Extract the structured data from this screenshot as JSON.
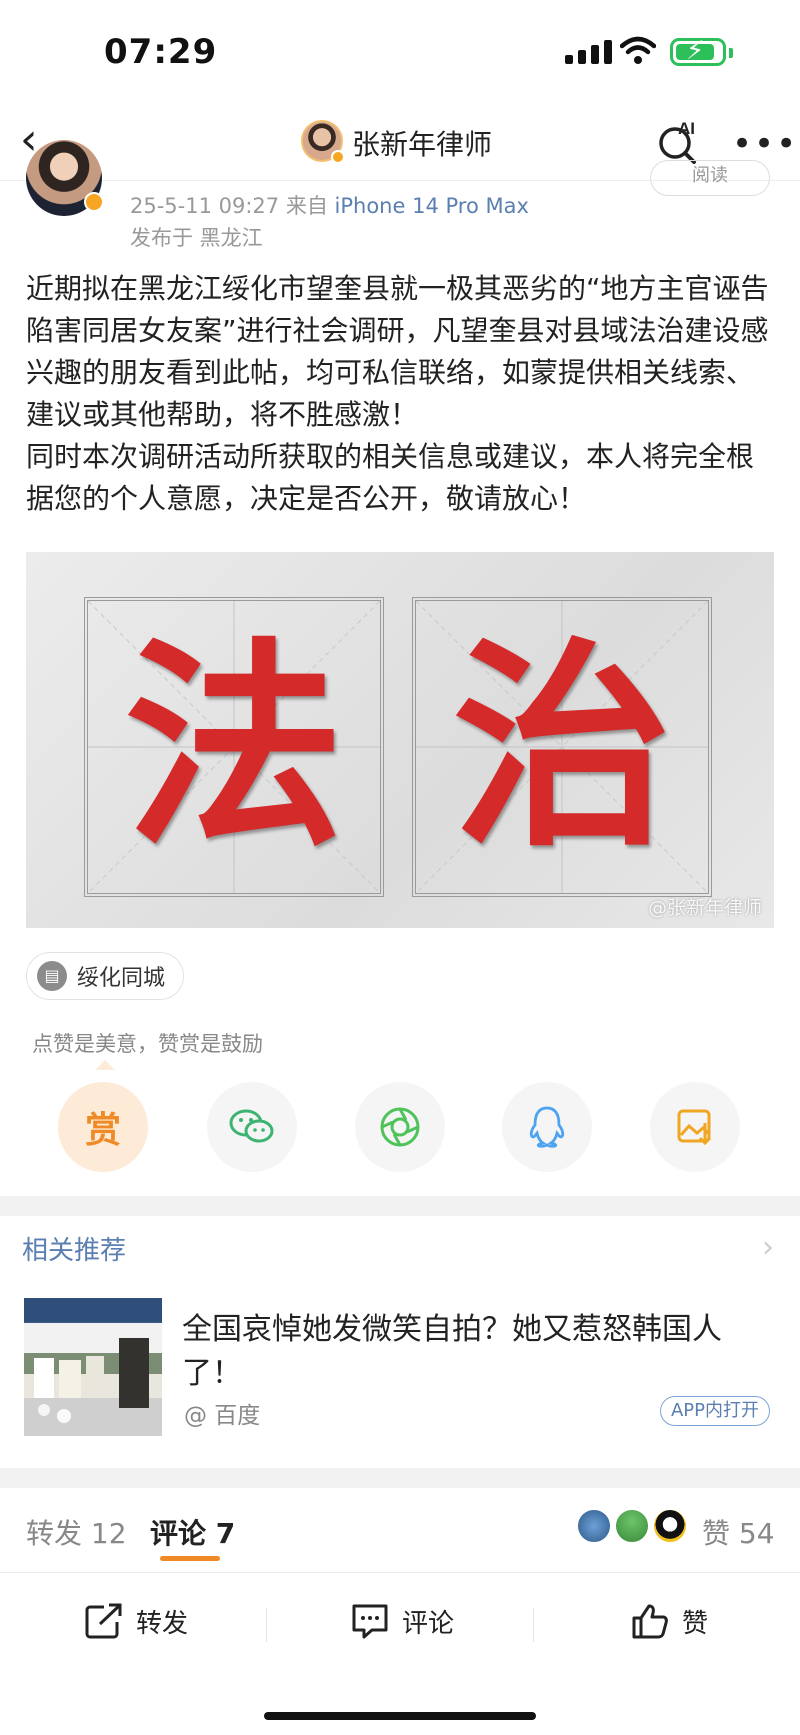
{
  "status_bar": {
    "time": "07:29"
  },
  "nav": {
    "title": "张新年律师",
    "ai_label": "AI",
    "more_label": "•••"
  },
  "post": {
    "follow_label": "阅读",
    "time": "25-5-11 09:27",
    "source_prefix": "来自",
    "device": "iPhone 14 Pro Max",
    "location": "发布于 黑龙江",
    "paragraphs": [
      "近期拟在黑龙江绥化市望奎县就一极其恶劣的“地方主官诬告陷害同居女友案”进行社会调研，凡望奎县对县域法治建设感兴趣的朋友看到此帖，均可私信联络，如蒙提供相关线索、建议或其他帮助，将不胜感激！",
      "同时本次调研活动所获取的相关信息或建议，本人将完全根据您的个人意愿，决定是否公开，敬请放心！"
    ],
    "image": {
      "char1": "法",
      "char2": "治",
      "watermark": "@张新年律师"
    },
    "tag": "绥化同城",
    "like_note": "点赞是美意，赞赏是鼓励",
    "reward_label": "赏"
  },
  "share_icons": [
    "reward-icon",
    "wechat-icon",
    "moments-icon",
    "qq-icon",
    "save-image-icon"
  ],
  "related": {
    "section_title": "相关推荐",
    "headline": "全国哀悼她发微笑自拍？她又惹怒韩国人了！",
    "source": "@ 百度",
    "open_app": "APP内打开"
  },
  "tabs": {
    "repost": "转发 12",
    "comment": "评论 7",
    "like": "赞 54"
  },
  "bottom_bar": {
    "repost": "转发",
    "comment": "评论",
    "like": "赞"
  },
  "colors": {
    "accent": "#f08a26",
    "link": "#5b7fb1",
    "red": "#d42a2a"
  }
}
